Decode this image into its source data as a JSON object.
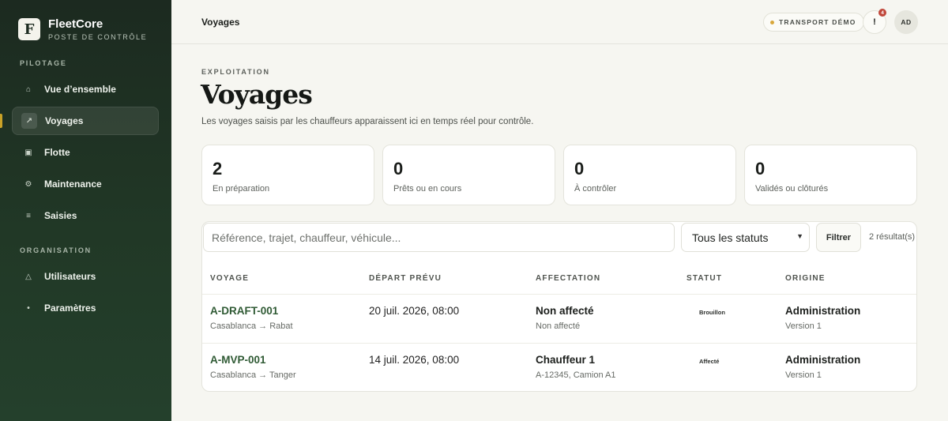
{
  "brand": {
    "logo_letter": "F",
    "name": "FleetCore",
    "subtitle": "POSTE DE CONTRÔLE"
  },
  "sidebar": {
    "sections": [
      {
        "label": "PILOTAGE",
        "items": [
          {
            "label": "Vue d’ensemble",
            "icon": "home-icon",
            "glyph": "⌂",
            "active": false
          },
          {
            "label": "Voyages",
            "icon": "arrow-up-right-icon",
            "glyph": "↗",
            "active": true
          },
          {
            "label": "Flotte",
            "icon": "square-icon",
            "glyph": "▣",
            "active": false
          },
          {
            "label": "Maintenance",
            "icon": "gear-icon",
            "glyph": "⚙",
            "active": false
          },
          {
            "label": "Saisies",
            "icon": "list-icon",
            "glyph": "≡",
            "active": false
          }
        ]
      },
      {
        "label": "ORGANISATION",
        "items": [
          {
            "label": "Utilisateurs",
            "icon": "triangle-icon",
            "glyph": "△",
            "active": false
          },
          {
            "label": "Paramètres",
            "icon": "dot-icon",
            "glyph": "•",
            "active": false
          }
        ]
      }
    ]
  },
  "topbar": {
    "title": "Voyages",
    "demo_badge": "TRANSPORT DÉMO",
    "notification_glyph": "!",
    "notification_count": "4",
    "avatar_initials": "AD"
  },
  "page": {
    "eyebrow": "EXPLOITATION",
    "title": "Voyages",
    "subtitle": "Les voyages saisis par les chauffeurs apparaissent ici en temps réel pour contrôle."
  },
  "stats": [
    {
      "value": "2",
      "label": "En préparation"
    },
    {
      "value": "0",
      "label": "Prêts ou en cours"
    },
    {
      "value": "0",
      "label": "À contrôler"
    },
    {
      "value": "0",
      "label": "Validés ou clôturés"
    }
  ],
  "filters": {
    "search_placeholder": "Référence, trajet, chauffeur, véhicule...",
    "status_selected": "Tous les statuts",
    "filter_button": "Filtrer",
    "result_count": "2 résultat(s)"
  },
  "table": {
    "headers": [
      "VOYAGE",
      "DÉPART PRÉVU",
      "AFFECTATION",
      "STATUT",
      "ORIGINE"
    ],
    "rows": [
      {
        "ref": "A-DRAFT-001",
        "route": "Casablanca → Rabat",
        "depart": "20 juil. 2026, 08:00",
        "assign_main": "Non affecté",
        "assign_sub": "Non affecté",
        "status": "Brouillon",
        "origin_main": "Administration",
        "origin_sub": "Version 1"
      },
      {
        "ref": "A-MVP-001",
        "route": "Casablanca → Tanger",
        "depart": "14 juil. 2026, 08:00",
        "assign_main": "Chauffeur 1",
        "assign_sub": "A-12345, Camion A1",
        "status": "Affecté",
        "origin_main": "Administration",
        "origin_sub": "Version 1"
      }
    ]
  },
  "colors": {
    "sidebar_bg": "#1f3224",
    "accent_green": "#2f5a34",
    "active_marker": "#c9a227",
    "page_bg": "#f6f6f1"
  }
}
